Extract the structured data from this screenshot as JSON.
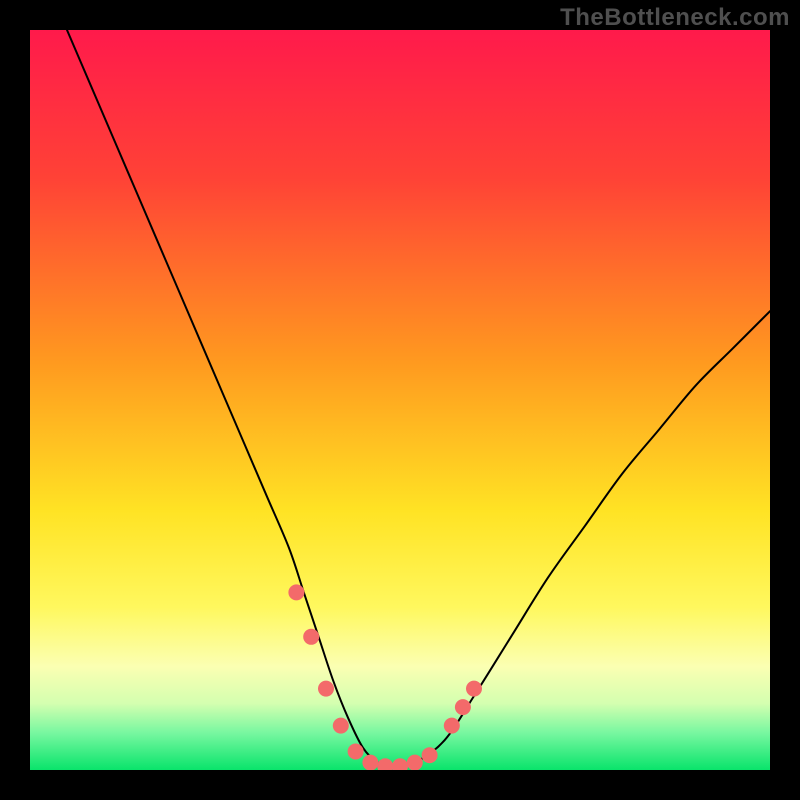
{
  "watermark": "TheBottleneck.com",
  "chart_data": {
    "type": "line",
    "title": "",
    "xlabel": "",
    "ylabel": "",
    "xlim": [
      0,
      100
    ],
    "ylim": [
      0,
      100
    ],
    "grid": false,
    "legend": false,
    "background_gradient": {
      "stops": [
        {
          "offset": 0.0,
          "color": "#ff1a4b"
        },
        {
          "offset": 0.2,
          "color": "#ff4236"
        },
        {
          "offset": 0.45,
          "color": "#ff9a1f"
        },
        {
          "offset": 0.65,
          "color": "#ffe324"
        },
        {
          "offset": 0.78,
          "color": "#fff85e"
        },
        {
          "offset": 0.86,
          "color": "#fbffb2"
        },
        {
          "offset": 0.91,
          "color": "#d4ffb0"
        },
        {
          "offset": 0.95,
          "color": "#77f7a0"
        },
        {
          "offset": 1.0,
          "color": "#09e46b"
        }
      ]
    },
    "series": [
      {
        "name": "bottleneck-curve",
        "stroke": "#000000",
        "stroke_width": 2,
        "x": [
          5,
          8,
          11,
          14,
          17,
          20,
          23,
          26,
          29,
          32,
          35,
          37,
          39,
          41,
          43,
          45,
          47,
          49,
          52,
          56,
          60,
          65,
          70,
          75,
          80,
          85,
          90,
          95,
          100
        ],
        "y": [
          100,
          93,
          86,
          79,
          72,
          65,
          58,
          51,
          44,
          37,
          30,
          24,
          18,
          12,
          7,
          3,
          1,
          0.5,
          1,
          4,
          10,
          18,
          26,
          33,
          40,
          46,
          52,
          57,
          62
        ]
      }
    ],
    "markers": {
      "name": "highlight-dots",
      "color": "#f36a6a",
      "radius_px": 8,
      "points": [
        {
          "x": 36,
          "y": 24
        },
        {
          "x": 38,
          "y": 18
        },
        {
          "x": 40,
          "y": 11
        },
        {
          "x": 42,
          "y": 6
        },
        {
          "x": 44,
          "y": 2.5
        },
        {
          "x": 46,
          "y": 1
        },
        {
          "x": 48,
          "y": 0.5
        },
        {
          "x": 50,
          "y": 0.5
        },
        {
          "x": 52,
          "y": 1
        },
        {
          "x": 54,
          "y": 2
        },
        {
          "x": 57,
          "y": 6
        },
        {
          "x": 58.5,
          "y": 8.5
        },
        {
          "x": 60,
          "y": 11
        }
      ]
    }
  }
}
